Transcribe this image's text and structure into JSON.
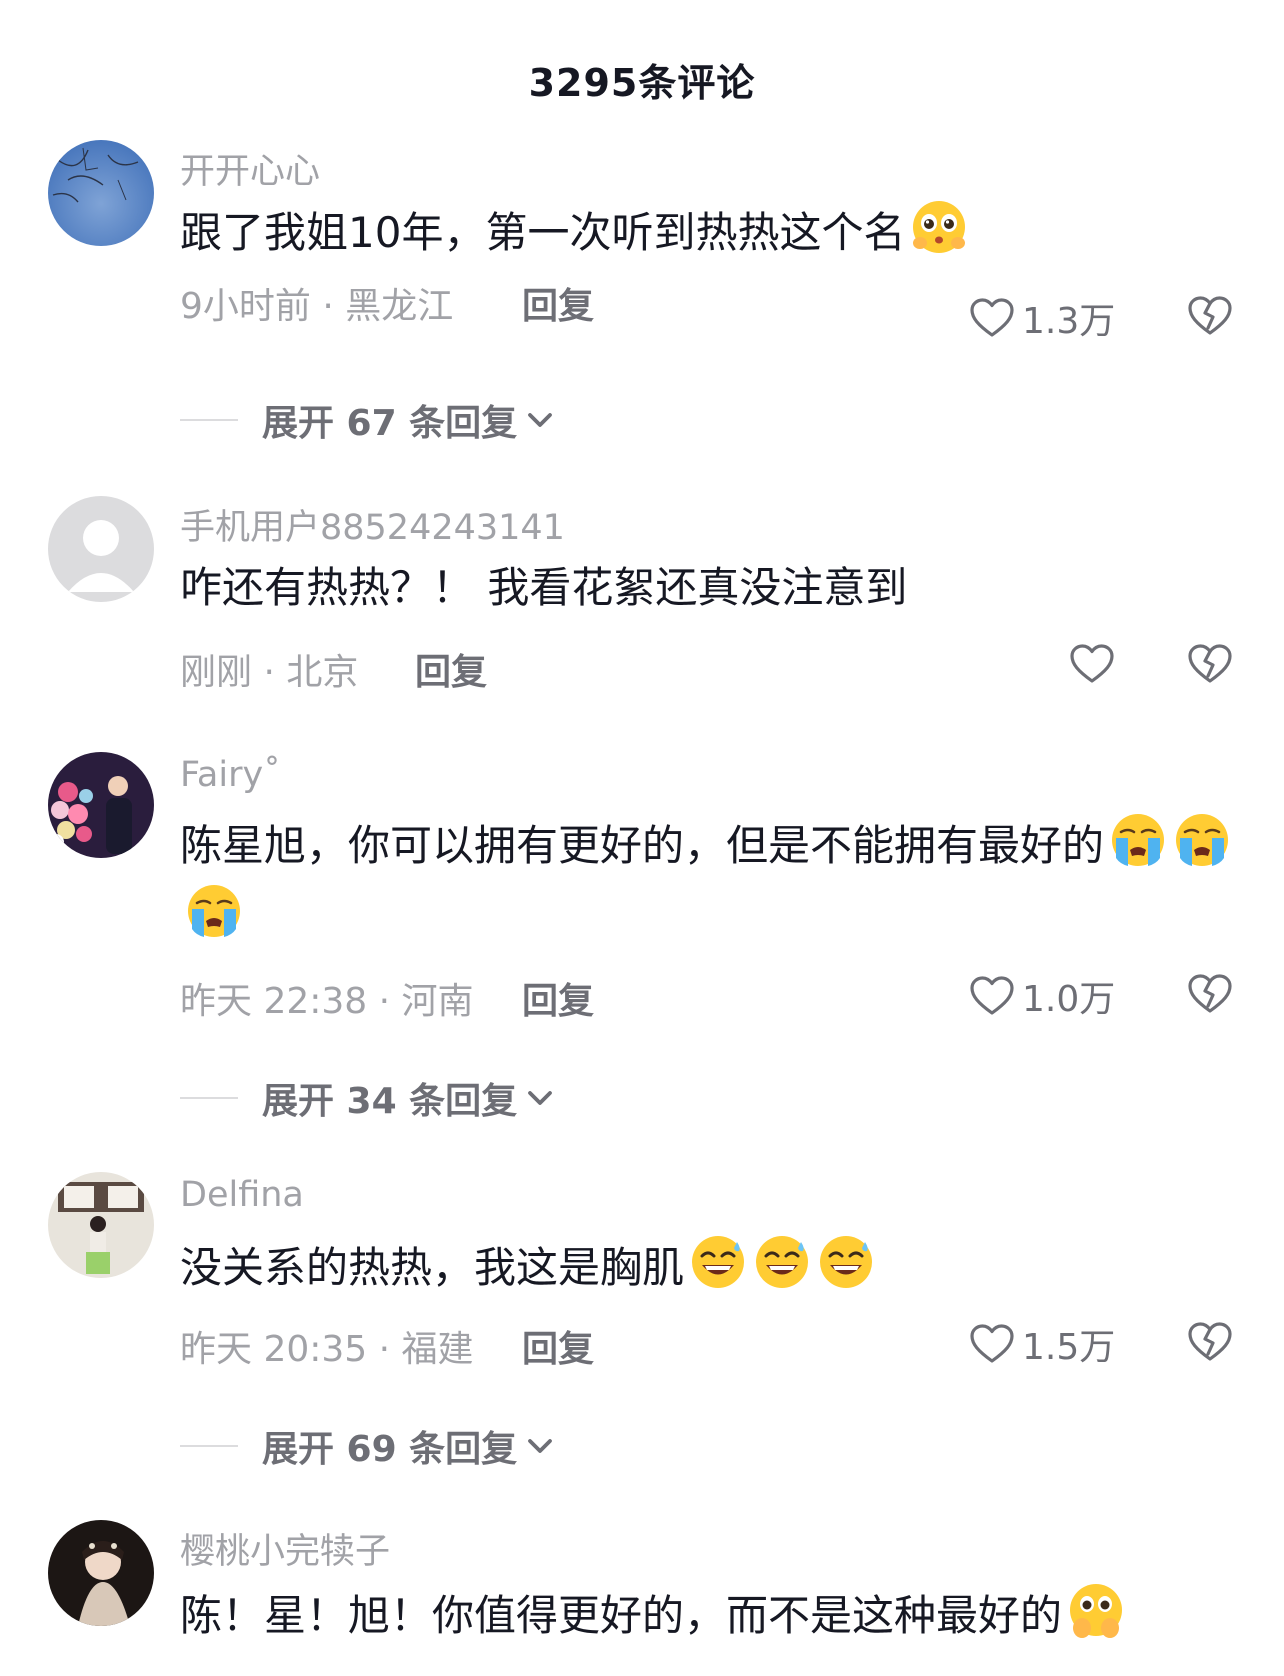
{
  "header": {
    "title": "3295条评论"
  },
  "icons": {
    "like": "heart-outline-icon",
    "dislike": "broken-heart-icon",
    "expand": "chevron-down-icon"
  },
  "comments": [
    {
      "username": "开开心心",
      "text": "跟了我姐10年，第一次听到热热这个名",
      "emojis": [
        "pleading-face-emoji"
      ],
      "time_location": "9小时前 · 黑龙江",
      "reply_label": "回复",
      "like_count": "1.3万",
      "expand_label": "展开 67 条回复"
    },
    {
      "username": "手机用户88524243141",
      "text": "咋还有热热？！ 我看花絮还真没注意到",
      "emojis": [],
      "time_location": "刚刚 · 北京",
      "reply_label": "回复",
      "like_count": ""
    },
    {
      "username": "Fairy˚",
      "text": "陈星旭，你可以拥有更好的，但是不能拥有最好的",
      "emojis": [
        "loudly-crying-face-emoji",
        "loudly-crying-face-emoji",
        "loudly-crying-face-emoji"
      ],
      "time_location": "昨天 22:38 · 河南",
      "reply_label": "回复",
      "like_count": "1.0万",
      "expand_label": "展开 34 条回复"
    },
    {
      "username": "Delfina",
      "text": "没关系的热热，我这是胸肌",
      "emojis": [
        "grinning-sweat-face-emoji",
        "grinning-sweat-face-emoji",
        "grinning-sweat-face-emoji"
      ],
      "time_location": "昨天 20:35 · 福建",
      "reply_label": "回复",
      "like_count": "1.5万",
      "expand_label": "展开 69 条回复"
    },
    {
      "username": "樱桃小完犊子",
      "text": "陈！星！旭！你值得更好的，而不是这种最好的",
      "emojis": [
        "face-holding-back-tears-emoji"
      ]
    }
  ]
}
